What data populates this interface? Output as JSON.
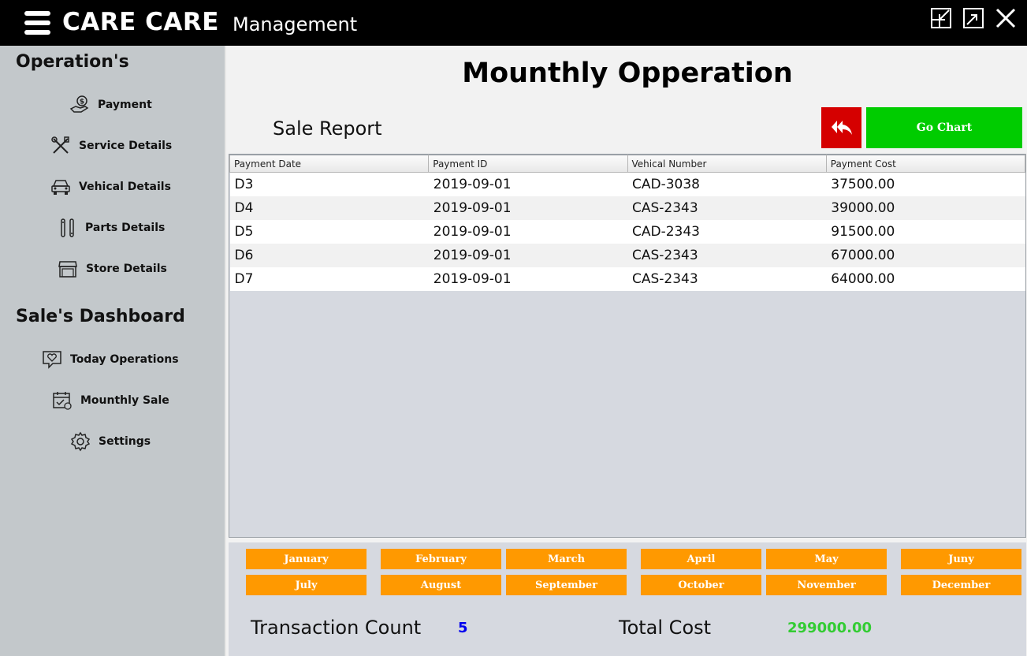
{
  "app": {
    "brand": "CARE CARE",
    "subtitle": "Management"
  },
  "sidebar": {
    "section1_title": "Operation's",
    "section1_items": [
      {
        "label": "Payment",
        "icon": "payment-hand-icon"
      },
      {
        "label": "Service Details",
        "icon": "tools-icon"
      },
      {
        "label": "Vehical Details",
        "icon": "car-icon"
      },
      {
        "label": "Parts Details",
        "icon": "parts-icon"
      },
      {
        "label": "Store Details",
        "icon": "store-icon"
      }
    ],
    "section2_title": "Sale's Dashboard",
    "section2_items": [
      {
        "label": "Today Operations",
        "icon": "chat-heart-icon"
      },
      {
        "label": "Mounthly Sale",
        "icon": "calendar-check-icon"
      },
      {
        "label": "Settings",
        "icon": "gear-icon"
      }
    ]
  },
  "main": {
    "title": "Mounthly Opperation",
    "report_label": "Sale Report",
    "go_chart_label": "Go Chart",
    "table": {
      "columns": [
        "Payment Date",
        "Payment ID",
        "Vehical Number",
        "Payment Cost"
      ],
      "rows": [
        [
          "D3",
          "2019-09-01",
          "CAD-3038",
          "37500.00"
        ],
        [
          "D4",
          "2019-09-01",
          "CAS-2343",
          "39000.00"
        ],
        [
          "D5",
          "2019-09-01",
          "CAD-2343",
          "91500.00"
        ],
        [
          "D6",
          "2019-09-01",
          "CAS-2343",
          "67000.00"
        ],
        [
          "D7",
          "2019-09-01",
          "CAS-2343",
          "64000.00"
        ]
      ]
    },
    "months": [
      "January",
      "February",
      "March",
      "April",
      "May",
      "Juny",
      "July",
      "August",
      "September",
      "October",
      "November",
      "December"
    ],
    "transaction_count_label": "Transaction Count",
    "transaction_count": "5",
    "total_cost_label": "Total Cost",
    "total_cost": "299000.00"
  },
  "colors": {
    "back_button": "#d50000",
    "go_chart_button": "#00cc00",
    "month_button": "#ff9900",
    "count_value": "#0000ee",
    "total_value": "#33cc33"
  }
}
